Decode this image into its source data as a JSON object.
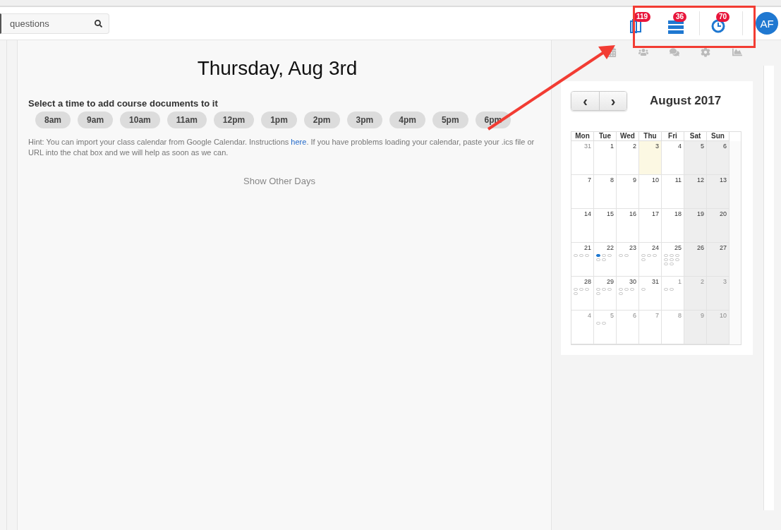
{
  "search": {
    "placeholder": "questions"
  },
  "header_icons": [
    {
      "kind": "book",
      "badge": "119"
    },
    {
      "kind": "list",
      "badge": "36"
    },
    {
      "kind": "clock",
      "badge": "70"
    }
  ],
  "avatar": "AF",
  "day_title": "Thursday, Aug 3rd",
  "prompt": "Select a time to add course documents to it",
  "times": [
    "8am",
    "9am",
    "10am",
    "11am",
    "12pm",
    "1pm",
    "2pm",
    "3pm",
    "4pm",
    "5pm",
    "6pm"
  ],
  "hint": {
    "before": "Hint: You can import your class calendar from Google Calendar. Instructions ",
    "link": "here",
    "after": ". If you have problems loading your calendar, paste your .ics file or URL into the chat box and we will help as soon as we can."
  },
  "show_other_days": "Show Other Days",
  "sidebar_tabs": [
    {
      "kind": "calendar",
      "selected": false
    },
    {
      "kind": "users",
      "selected": false
    },
    {
      "kind": "comments",
      "selected": false
    },
    {
      "kind": "settings",
      "selected": false
    },
    {
      "kind": "chart",
      "selected": false
    }
  ],
  "calendar": {
    "prev": "‹",
    "next": "›",
    "month": "August 2017",
    "weekdays": [
      "Mon",
      "Tue",
      "Wed",
      "Thu",
      "Fri",
      "Sat",
      "Sun"
    ],
    "weeks": [
      [
        {
          "label": "31",
          "other_month": true,
          "today": false
        },
        {
          "label": "1",
          "other_month": false,
          "today": false
        },
        {
          "label": "2",
          "other_month": false,
          "today": false
        },
        {
          "label": "3",
          "other_month": false,
          "today": true
        },
        {
          "label": "4",
          "other_month": false,
          "today": false
        },
        {
          "label": "5",
          "other_month": false,
          "today": false
        },
        {
          "label": "6",
          "other_month": false,
          "today": false
        }
      ],
      [
        {
          "label": "7",
          "other_month": false,
          "today": false
        },
        {
          "label": "8",
          "other_month": false,
          "today": false
        },
        {
          "label": "9",
          "other_month": false,
          "today": false
        },
        {
          "label": "10",
          "other_month": false,
          "today": false
        },
        {
          "label": "11",
          "other_month": false,
          "today": false
        },
        {
          "label": "12",
          "other_month": false,
          "today": false
        },
        {
          "label": "13",
          "other_month": false,
          "today": false
        }
      ],
      [
        {
          "label": "14",
          "other_month": false,
          "today": false
        },
        {
          "label": "15",
          "other_month": false,
          "today": false
        },
        {
          "label": "16",
          "other_month": false,
          "today": false
        },
        {
          "label": "17",
          "other_month": false,
          "today": false
        },
        {
          "label": "18",
          "other_month": false,
          "today": false
        },
        {
          "label": "19",
          "other_month": false,
          "today": false
        },
        {
          "label": "20",
          "other_month": false,
          "today": false
        }
      ],
      [
        {
          "label": "21",
          "other_month": false,
          "today": false,
          "events": [
            {
              "filled": false
            },
            {
              "filled": false
            },
            {
              "filled": false
            }
          ]
        },
        {
          "label": "22",
          "other_month": false,
          "today": false,
          "events": [
            {
              "filled": true
            },
            {
              "filled": false
            },
            {
              "filled": false
            },
            {
              "filled": false
            },
            {
              "filled": false
            }
          ]
        },
        {
          "label": "23",
          "other_month": false,
          "today": false,
          "events": [
            {
              "filled": false
            },
            {
              "filled": false
            }
          ]
        },
        {
          "label": "24",
          "other_month": false,
          "today": false,
          "events": [
            {
              "filled": false
            },
            {
              "filled": false
            },
            {
              "filled": false
            },
            {
              "filled": false
            }
          ]
        },
        {
          "label": "25",
          "other_month": false,
          "today": false,
          "events": [
            {
              "filled": false
            },
            {
              "filled": false
            },
            {
              "filled": false
            },
            {
              "filled": false
            },
            {
              "filled": false
            },
            {
              "filled": false
            },
            {
              "filled": false
            },
            {
              "filled": false
            }
          ]
        },
        {
          "label": "26",
          "other_month": false,
          "today": false
        },
        {
          "label": "27",
          "other_month": false,
          "today": false
        }
      ],
      [
        {
          "label": "28",
          "other_month": false,
          "today": false,
          "events": [
            {
              "filled": false
            },
            {
              "filled": false
            },
            {
              "filled": false
            },
            {
              "filled": false
            }
          ]
        },
        {
          "label": "29",
          "other_month": false,
          "today": false,
          "events": [
            {
              "filled": false
            },
            {
              "filled": false
            },
            {
              "filled": false
            },
            {
              "filled": false
            }
          ]
        },
        {
          "label": "30",
          "other_month": false,
          "today": false,
          "events": [
            {
              "filled": false
            },
            {
              "filled": false
            },
            {
              "filled": false
            },
            {
              "filled": false
            }
          ]
        },
        {
          "label": "31",
          "other_month": false,
          "today": false,
          "events": [
            {
              "filled": false
            }
          ]
        },
        {
          "label": "1",
          "other_month": true,
          "today": false,
          "events": [
            {
              "filled": false
            },
            {
              "filled": false
            }
          ]
        },
        {
          "label": "2",
          "other_month": true,
          "today": false
        },
        {
          "label": "3",
          "other_month": true,
          "today": false
        }
      ],
      [
        {
          "label": "4",
          "other_month": true,
          "today": false
        },
        {
          "label": "5",
          "other_month": true,
          "today": false,
          "events": [
            {
              "filled": false
            },
            {
              "filled": false
            }
          ]
        },
        {
          "label": "6",
          "other_month": true,
          "today": false
        },
        {
          "label": "7",
          "other_month": true,
          "today": false
        },
        {
          "label": "8",
          "other_month": true,
          "today": false
        },
        {
          "label": "9",
          "other_month": true,
          "today": false
        },
        {
          "label": "10",
          "other_month": true,
          "today": false
        }
      ]
    ]
  }
}
